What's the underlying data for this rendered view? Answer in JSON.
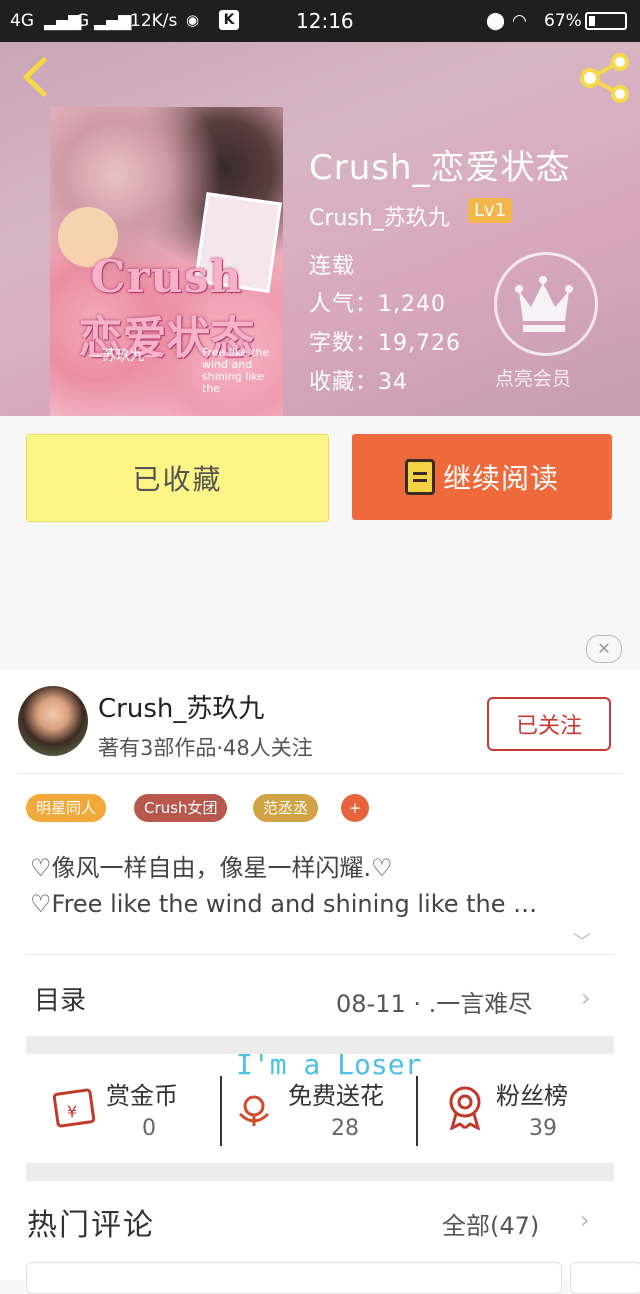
{
  "status_bar": {
    "network": "4G",
    "network2": "G",
    "speed": "12K/s",
    "app_badge": "K",
    "time": "12:16",
    "battery": "67%"
  },
  "book": {
    "title": "Crush_恋爱状态",
    "author": "Crush_苏玖九",
    "level": "Lv1",
    "status": "连载",
    "popularity": "人气：1,240",
    "word_count": "字数：19,726",
    "favorites": "收藏：34",
    "vip_label": "点亮会员"
  },
  "cover": {
    "title_line1": "Crush",
    "title_line2": "恋爱状态",
    "author": "—苏玖九—",
    "quote": "Free like the wind and shining like the"
  },
  "actions": {
    "favorited_label": "已收藏",
    "continue_label": "继续阅读"
  },
  "ad": {
    "close": "✕"
  },
  "author_card": {
    "name": "Crush_苏玖九",
    "meta": "著有3部作品·48人关注",
    "follow_label": "已关注"
  },
  "tags": [
    {
      "label": "明星同人",
      "color": "#f2a93b"
    },
    {
      "label": "Crush女团",
      "color": "#b8574c"
    },
    {
      "label": "范丞丞",
      "color": "#d2a345"
    },
    {
      "label": "+",
      "color": "#e6633c"
    }
  ],
  "description": {
    "line1": "♡像风一样自由，像星一样闪耀.♡",
    "line2": "♡Free like the wind and shining like the …"
  },
  "toc": {
    "label": "目录",
    "latest": "08-11 · .一言难尽"
  },
  "watermark": "I'm a Loser",
  "rewards": [
    {
      "label": "赏金币",
      "value": "0",
      "icon": "red-envelope-icon"
    },
    {
      "label": "免费送花",
      "value": "28",
      "icon": "flower-icon"
    },
    {
      "label": "粉丝榜",
      "value": "39",
      "icon": "medal-icon"
    }
  ],
  "hot_comments": {
    "label": "热门评论",
    "all": "全部(47)"
  }
}
